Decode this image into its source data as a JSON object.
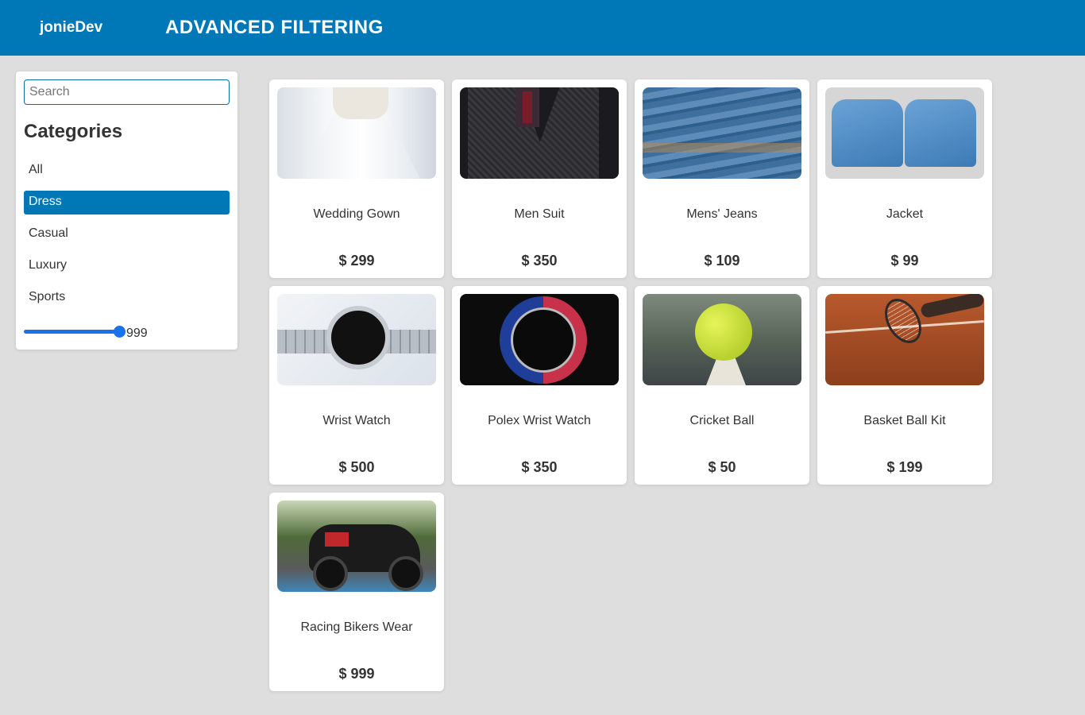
{
  "header": {
    "brand": "jonieDev",
    "title": "ADVANCED FILTERING",
    "background_color": "#0077b6"
  },
  "sidebar": {
    "search": {
      "placeholder": "Search",
      "value": ""
    },
    "categories_heading": "Categories",
    "categories": [
      {
        "label": "All",
        "active": false
      },
      {
        "label": "Dress",
        "active": true
      },
      {
        "label": "Casual",
        "active": false
      },
      {
        "label": "Luxury",
        "active": false
      },
      {
        "label": "Sports",
        "active": false
      }
    ],
    "price_slider": {
      "value": 999,
      "label": "999",
      "fill_fraction": 1.0
    },
    "active_color": "#0077b6"
  },
  "products": [
    {
      "name": "Wedding Gown",
      "price": "$ 299",
      "image": "wedding-gown-image"
    },
    {
      "name": "Men Suit",
      "price": "$ 350",
      "image": "men-suit-image"
    },
    {
      "name": "Mens' Jeans",
      "price": "$ 109",
      "image": "jeans-image"
    },
    {
      "name": "Jacket",
      "price": "$ 99",
      "image": "jacket-image"
    },
    {
      "name": "Wrist Watch",
      "price": "$ 500",
      "image": "wrist-watch-image"
    },
    {
      "name": "Polex Wrist Watch",
      "price": "$ 350",
      "image": "polex-watch-image"
    },
    {
      "name": "Cricket Ball",
      "price": "$ 50",
      "image": "ball-image"
    },
    {
      "name": "Basket Ball Kit",
      "price": "$ 199",
      "image": "tennis-racket-image"
    },
    {
      "name": "Racing Bikers Wear",
      "price": "$ 999",
      "image": "motorbike-image"
    }
  ]
}
